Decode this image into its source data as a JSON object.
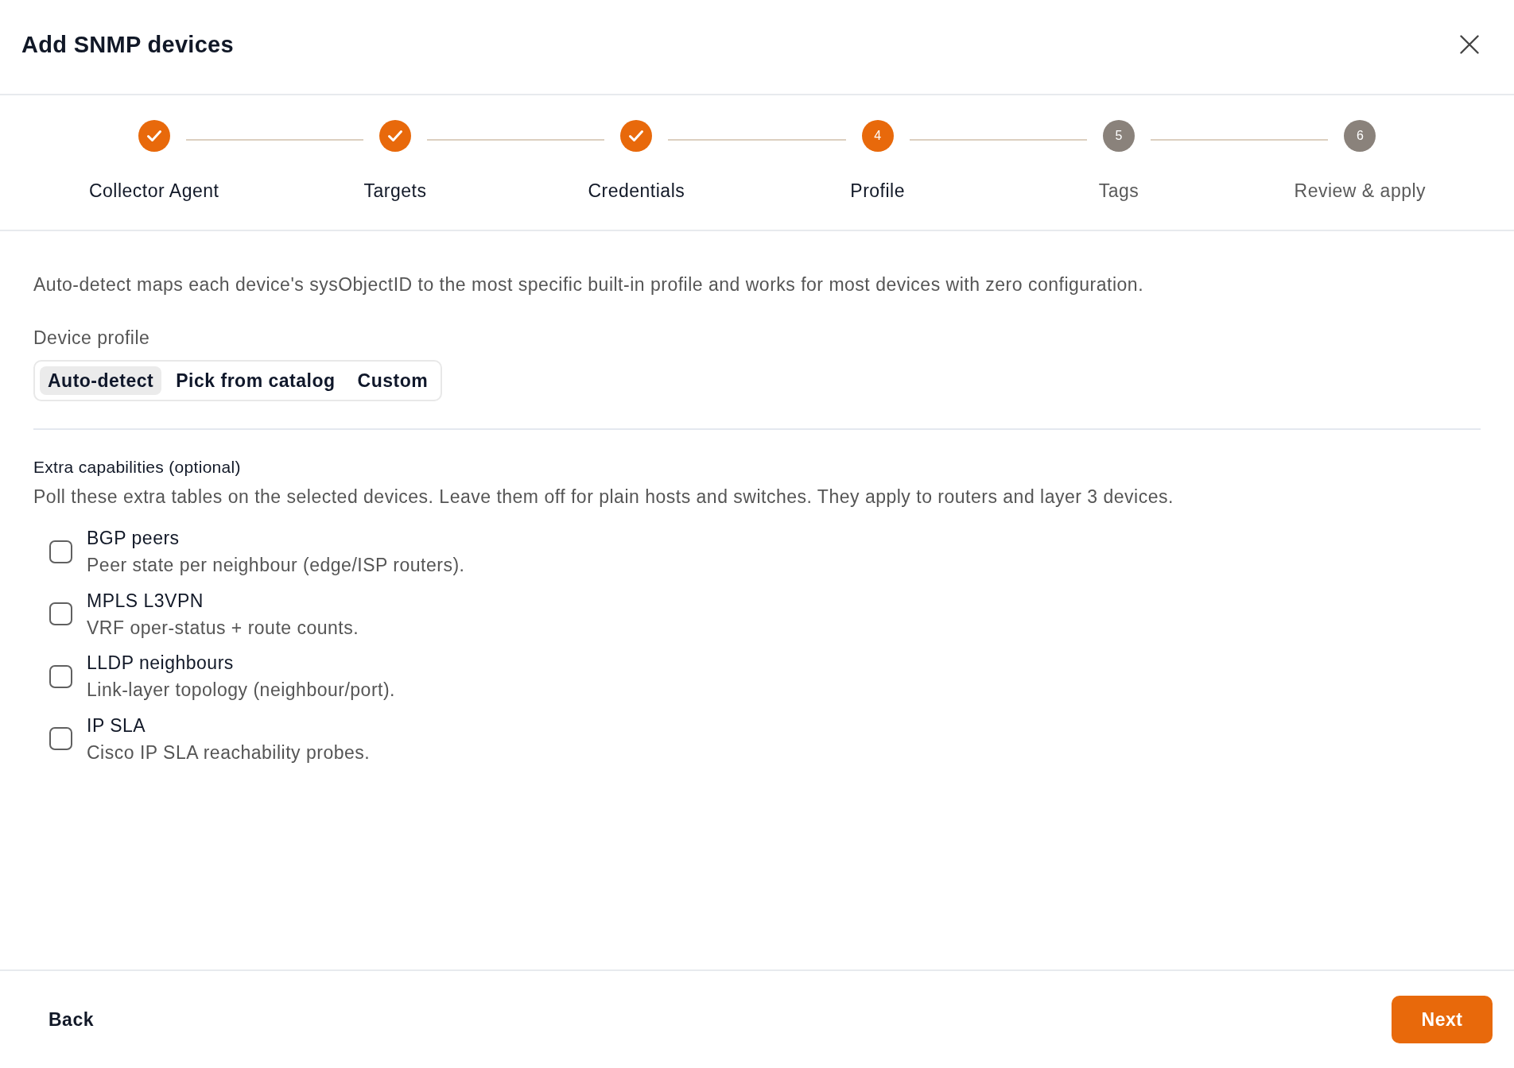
{
  "dialog": {
    "title": "Add SNMP devices"
  },
  "stepper": {
    "steps": [
      {
        "label": "Collector Agent",
        "completed": true,
        "current": false
      },
      {
        "label": "Targets",
        "completed": true,
        "current": false
      },
      {
        "label": "Credentials",
        "completed": true,
        "current": false
      },
      {
        "label": "Profile",
        "number": "4",
        "completed": false,
        "current": true
      },
      {
        "label": "Tags",
        "number": "5",
        "completed": false,
        "current": false
      },
      {
        "label": "Review & apply",
        "number": "6",
        "completed": false,
        "current": false
      }
    ]
  },
  "profile": {
    "description": "Auto-detect maps each device's sysObjectID to the most specific built-in profile and works for most devices with zero configuration.",
    "label": "Device profile",
    "options": [
      {
        "label": "Auto-detect",
        "selected": true
      },
      {
        "label": "Pick from catalog",
        "selected": false
      },
      {
        "label": "Custom",
        "selected": false
      }
    ]
  },
  "capabilities": {
    "title": "Extra capabilities (optional)",
    "description": "Poll these extra tables on the selected devices. Leave them off for plain hosts and switches. They apply to routers and layer 3 devices.",
    "items": [
      {
        "title": "BGP peers",
        "description": "Peer state per neighbour (edge/ISP routers).",
        "checked": false
      },
      {
        "title": "MPLS L3VPN",
        "description": "VRF oper-status + route counts.",
        "checked": false
      },
      {
        "title": "LLDP neighbours",
        "description": "Link-layer topology (neighbour/port).",
        "checked": false
      },
      {
        "title": "IP SLA",
        "description": "Cisco IP SLA reachability probes.",
        "checked": false
      }
    ]
  },
  "footer": {
    "back": "Back",
    "next": "Next"
  }
}
